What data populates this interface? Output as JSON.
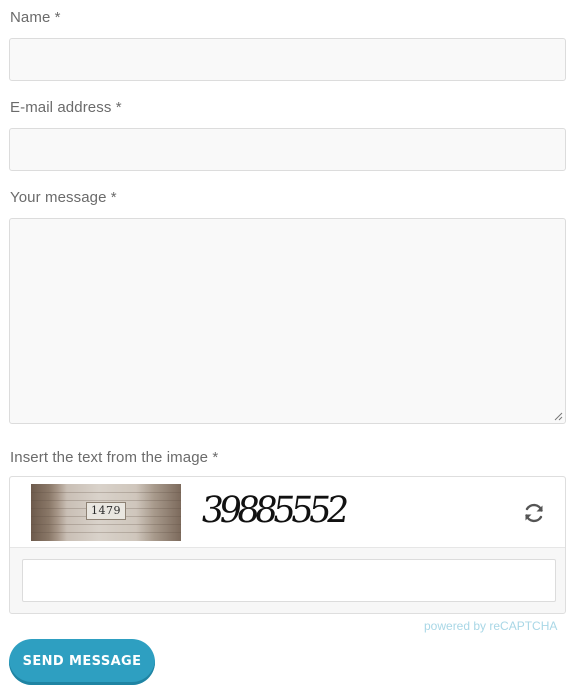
{
  "form": {
    "name_label": "Name *",
    "name_value": "",
    "email_label": "E-mail address *",
    "email_value": "",
    "message_label": "Your message *",
    "message_value": "",
    "captcha_label": "Insert the text from the image *"
  },
  "captcha": {
    "house_number": "1479",
    "word": "39885552",
    "input_value": "",
    "refresh_icon": "refresh-icon",
    "powered_by": "powered by reCAPTCHA"
  },
  "submit": {
    "label": "SEND MESSAGE"
  },
  "colors": {
    "button": "#2e9fc1",
    "powered_text": "#a9d7e6",
    "field_bg": "#f9f9f9",
    "border": "#dcdcdc"
  }
}
